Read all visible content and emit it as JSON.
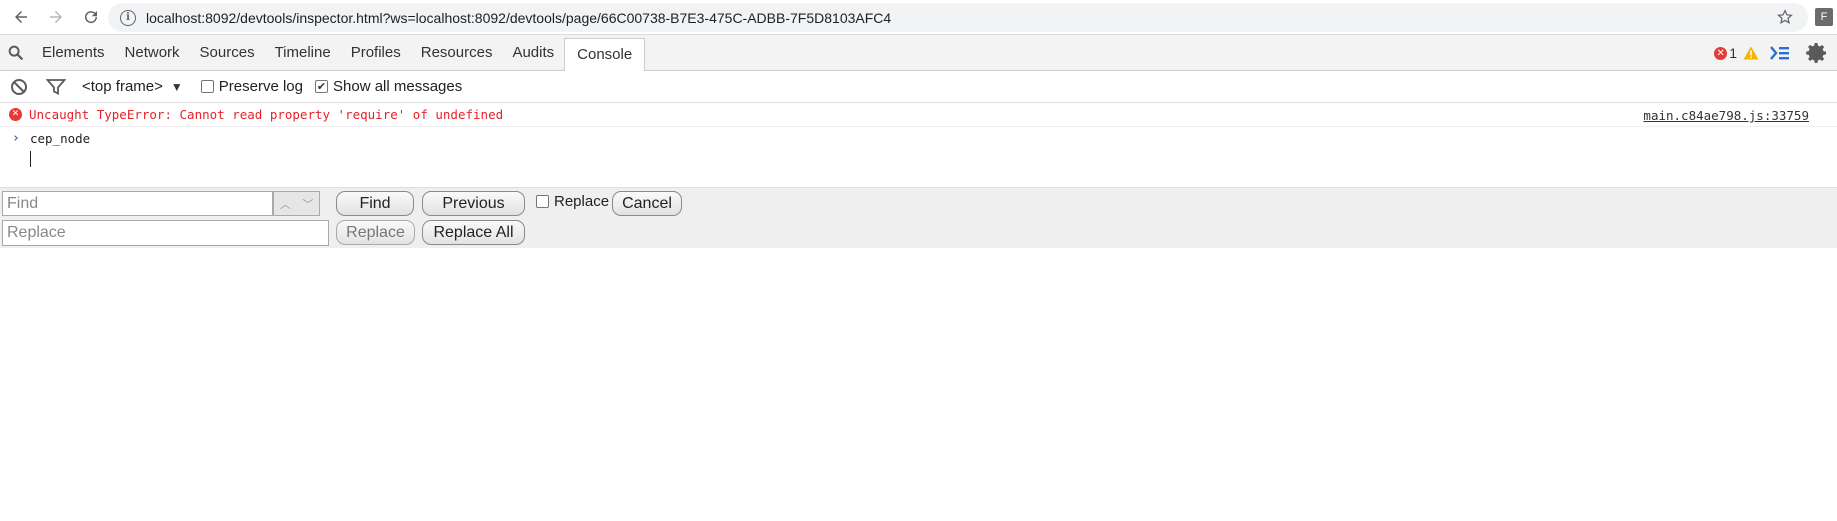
{
  "browser": {
    "url": "localhost:8092/devtools/inspector.html?ws=localhost:8092/devtools/page/66C00738-B7E3-475C-ADBB-7F5D8103AFC4",
    "profile_initial": "F",
    "icons": [
      "back-arrow-icon",
      "forward-arrow-icon",
      "reload-icon",
      "info-icon",
      "star-icon"
    ]
  },
  "devtools": {
    "tabs": [
      {
        "label": "Elements"
      },
      {
        "label": "Network"
      },
      {
        "label": "Sources"
      },
      {
        "label": "Timeline"
      },
      {
        "label": "Profiles"
      },
      {
        "label": "Resources"
      },
      {
        "label": "Audits"
      },
      {
        "label": "Console"
      }
    ],
    "active_tab": "Console",
    "error_count": "1"
  },
  "console_toolbar": {
    "frame": "<top frame>",
    "preserve_log_label": "Preserve log",
    "preserve_log_checked": false,
    "show_all_label": "Show all messages",
    "show_all_checked": true
  },
  "console": {
    "error_message": "Uncaught TypeError: Cannot read property 'require' of undefined",
    "error_source": "main.c84ae798.js:33759",
    "command": "cep_node"
  },
  "find_bar": {
    "find_placeholder": "Find",
    "replace_placeholder": "Replace",
    "find_button": "Find",
    "previous_button": "Previous",
    "replace_checkbox_label": "Replace",
    "cancel_button": "Cancel",
    "replace_button": "Replace",
    "replace_all_button": "Replace All"
  },
  "colors": {
    "error_red": "#e5222a",
    "accent_blue": "#2d6ed1",
    "tabbar_bg": "#f3f3f3",
    "findbar_bg": "#efefef"
  }
}
